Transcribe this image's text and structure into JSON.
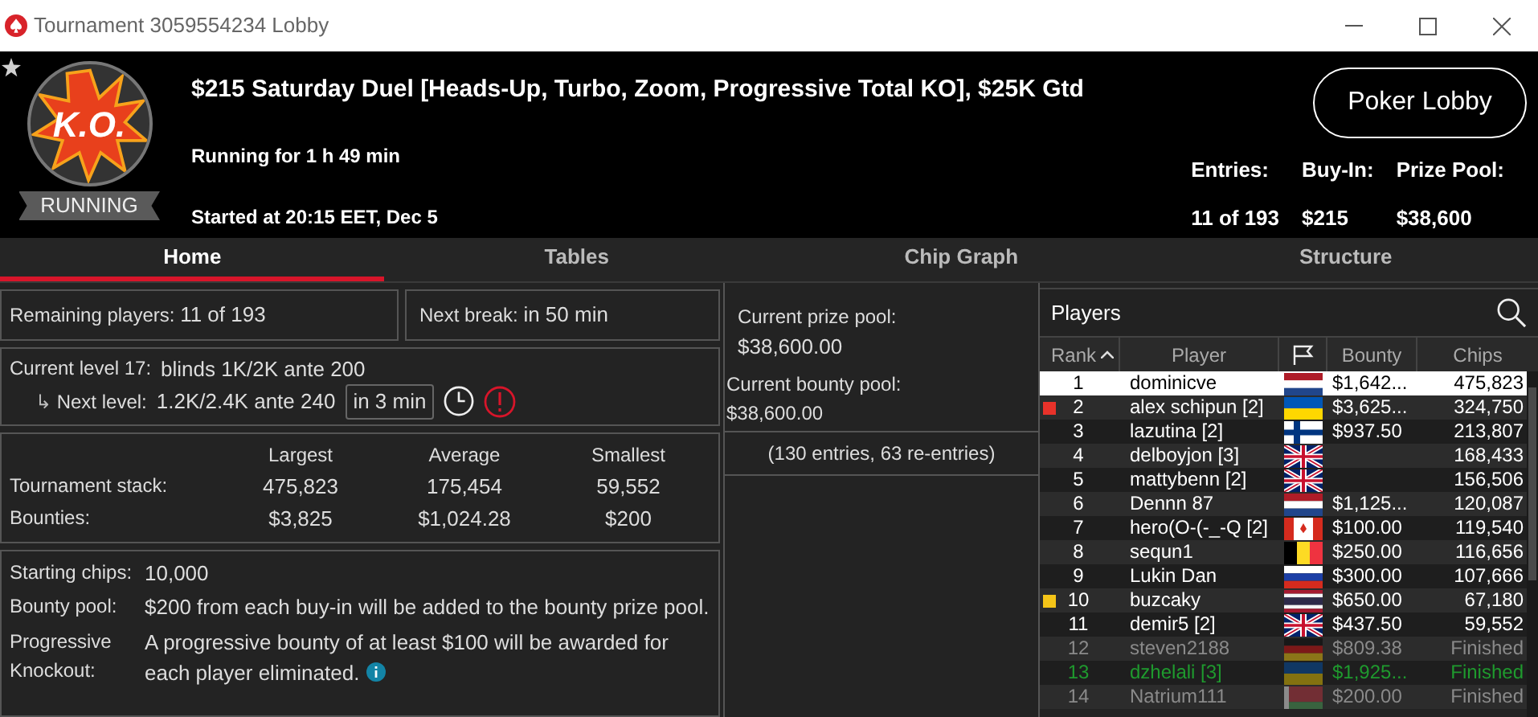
{
  "window": {
    "title": "Tournament 3059554234 Lobby"
  },
  "header": {
    "logo_text": "K.O.",
    "status": "RUNNING",
    "favorite": false,
    "name": "$215 Saturday Duel [Heads-Up, Turbo, Zoom, Progressive Total KO], $25K Gtd",
    "running_for": "Running for 1 h 49 min",
    "started": "Started at 20:15 EET, Dec 5",
    "lobby_button": "Poker Lobby",
    "stats": [
      {
        "label": "Entries:",
        "value": "11 of 193"
      },
      {
        "label": "Buy-In:",
        "value": "$215"
      },
      {
        "label": "Prize Pool:",
        "value": "$38,600"
      }
    ]
  },
  "tabs": [
    {
      "label": "Home",
      "selected": true
    },
    {
      "label": "Tables",
      "selected": false
    },
    {
      "label": "Chip Graph",
      "selected": false
    },
    {
      "label": "Structure",
      "selected": false
    }
  ],
  "home": {
    "remaining": {
      "label": "Remaining players:",
      "value": "11 of 193"
    },
    "next_break": {
      "label": "Next break:",
      "value": "in 50 min"
    },
    "current_level": {
      "label": "Current level 17:",
      "value": "blinds 1K/2K ante 200"
    },
    "next_level": {
      "arrow": "↳",
      "label": "Next level:",
      "value": "1.2K/2.4K ante 240",
      "countdown": "in 3 min"
    },
    "stack_table": {
      "columns": [
        "Largest",
        "Average",
        "Smallest"
      ],
      "rows": [
        {
          "label": "Tournament stack:",
          "values": [
            "475,823",
            "175,454",
            "59,552"
          ]
        },
        {
          "label": "Bounties:",
          "values": [
            "$3,825",
            "$1,024.28",
            "$200"
          ]
        }
      ]
    },
    "info": [
      {
        "label": "Starting chips:",
        "value": "10,000",
        "info": false
      },
      {
        "label": "Bounty pool:",
        "value": "$200 from each buy-in will be added to the bounty prize pool.",
        "info": false
      },
      {
        "label": "Progressive Knockout:",
        "value": "A progressive bounty of at least $100 will be awarded for each player eliminated.",
        "info": true
      }
    ]
  },
  "prize": {
    "prize_label": "Current prize pool:",
    "prize_value": "$38,600.00",
    "bounty_label": "Current bounty pool:",
    "bounty_value": "$38,600.00",
    "entries": "(130 entries, 63 re-entries)"
  },
  "players": {
    "title": "Players",
    "columns": [
      "Rank",
      "Player",
      "Bounty",
      "Chips"
    ],
    "rows": [
      {
        "rank": "1",
        "player": "dominicve",
        "flag": {
          "kind": "nl"
        },
        "bounty": "$1,642...",
        "chips": "475,823",
        "kind": "playing",
        "selected": true
      },
      {
        "rank": "2",
        "player": "alex schipun [2]",
        "flag": {
          "kind": "ua"
        },
        "bounty": "$3,625...",
        "chips": "324,750",
        "kind": "playing",
        "selected": false,
        "color": "#e8322a"
      },
      {
        "rank": "3",
        "player": "lazutina [2]",
        "flag": {
          "kind": "fi"
        },
        "bounty": "$937.50",
        "chips": "213,807",
        "kind": "playing",
        "selected": false
      },
      {
        "rank": "4",
        "player": "delboyjon [3]",
        "flag": {
          "kind": "gb"
        },
        "bounty": "",
        "chips": "168,433",
        "kind": "playing",
        "selected": false
      },
      {
        "rank": "5",
        "player": "mattybenn [2]",
        "flag": {
          "kind": "gb"
        },
        "bounty": "",
        "chips": "156,506",
        "kind": "playing",
        "selected": false
      },
      {
        "rank": "6",
        "player": "Dennn 87",
        "flag": {
          "kind": "nl"
        },
        "bounty": "$1,125...",
        "chips": "120,087",
        "kind": "playing",
        "selected": false
      },
      {
        "rank": "7",
        "player": "hero(O-(-_-Q [2]",
        "flag": {
          "kind": "ca"
        },
        "bounty": "$100.00",
        "chips": "119,540",
        "kind": "playing",
        "selected": false
      },
      {
        "rank": "8",
        "player": "sequn1",
        "flag": {
          "kind": "be"
        },
        "bounty": "$250.00",
        "chips": "116,656",
        "kind": "playing",
        "selected": false
      },
      {
        "rank": "9",
        "player": "Lukin Dan",
        "flag": {
          "kind": "ru"
        },
        "bounty": "$300.00",
        "chips": "107,666",
        "kind": "playing",
        "selected": false
      },
      {
        "rank": "10",
        "player": "buzcaky",
        "flag": {
          "kind": "th"
        },
        "bounty": "$650.00",
        "chips": "67,180",
        "kind": "playing",
        "selected": false,
        "color": "#f5c518"
      },
      {
        "rank": "11",
        "player": "demir5 [2]",
        "flag": {
          "kind": "gb"
        },
        "bounty": "$437.50",
        "chips": "59,552",
        "kind": "playing",
        "selected": false
      },
      {
        "rank": "12",
        "player": "steven2188",
        "flag": {
          "kind": "de"
        },
        "bounty": "$809.38",
        "chips": "Finished",
        "kind": "finished",
        "selected": false
      },
      {
        "rank": "13",
        "player": "dzhelali [3]",
        "flag": {
          "kind": "ua"
        },
        "bounty": "$1,925...",
        "chips": "Finished",
        "kind": "buddy",
        "selected": false
      },
      {
        "rank": "14",
        "player": "Natrium111",
        "flag": {
          "kind": "by"
        },
        "bounty": "$200.00",
        "chips": "Finished",
        "kind": "finished",
        "selected": false
      }
    ]
  }
}
